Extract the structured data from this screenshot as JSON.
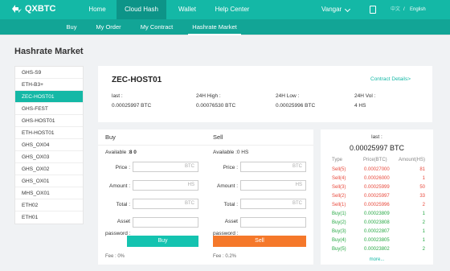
{
  "nav": {
    "logo": "QXBTC",
    "links": [
      "Home",
      "Cloud Hash",
      "Wallet",
      "Help Center"
    ],
    "user": "Vangar",
    "lang_cn": "中文",
    "lang_sep": "/",
    "lang_en": "English"
  },
  "subnav": [
    "Buy",
    "My Order",
    "My Contract",
    "Hashrate Market"
  ],
  "page_title": "Hashrate Market",
  "sidebar": [
    "GHS-S9",
    "ETH-B3+",
    "ZEC-HOST01",
    "GHS-FEST",
    "GHS-HOST01",
    "ETH-HOST01",
    "GHS_OX04",
    "GHS_OX03",
    "GHS_OX02",
    "GHS_OX01",
    "MHS_OX01",
    "ETH02",
    "ETH01"
  ],
  "info": {
    "name": "ZEC-HOST01",
    "details_link": "Contract Details>",
    "stats": [
      {
        "label": "last :",
        "value": "0.00025997 BTC"
      },
      {
        "label": "24H High :",
        "value": "0.00076530 BTC"
      },
      {
        "label": "24H Low :",
        "value": "0.00025996 BTC"
      },
      {
        "label": "24H Vol :",
        "value": "4 HS"
      }
    ]
  },
  "buy": {
    "title": "Buy",
    "available_label": "Available :",
    "available_value": "8 0",
    "price_label": "Price :",
    "price_unit": "BTC",
    "amount_label": "Amount :",
    "amount_unit": "HS",
    "total_label": "Total :",
    "total_unit": "BTC",
    "asset_label_1": "Asset",
    "asset_label_2": "password :",
    "button": "Buy",
    "fee": "Fee : 0%"
  },
  "sell": {
    "title": "Sell",
    "available_label": "Available :",
    "available_value": "0 HS",
    "price_label": "Price :",
    "price_unit": "BTC",
    "amount_label": "Amount :",
    "amount_unit": "HS",
    "total_label": "Total :",
    "total_unit": "BTC",
    "asset_label_1": "Asset",
    "asset_label_2": "password :",
    "button": "Sell",
    "fee": "Fee : 0.2%"
  },
  "book": {
    "last_label": "last :",
    "last_value": "0.00025997 BTC",
    "headers": [
      "Type",
      "Price(BTC)",
      "Amount(HS)"
    ],
    "rows": [
      {
        "type": "Sell(5)",
        "price": "0.00027000",
        "amount": "81",
        "side": "s"
      },
      {
        "type": "Sell(4)",
        "price": "0.00026000",
        "amount": "1",
        "side": "s"
      },
      {
        "type": "Sell(3)",
        "price": "0.00025999",
        "amount": "50",
        "side": "s"
      },
      {
        "type": "Sell(2)",
        "price": "0.00025997",
        "amount": "33",
        "side": "s"
      },
      {
        "type": "Sell(1)",
        "price": "0.00025996",
        "amount": "2",
        "side": "s"
      },
      {
        "type": "Buy(1)",
        "price": "0.00023809",
        "amount": "1",
        "side": "b"
      },
      {
        "type": "Buy(2)",
        "price": "0.00023808",
        "amount": "2",
        "side": "b"
      },
      {
        "type": "Buy(3)",
        "price": "0.00022807",
        "amount": "1",
        "side": "b"
      },
      {
        "type": "Buy(4)",
        "price": "0.00023805",
        "amount": "1",
        "side": "b"
      },
      {
        "type": "Buy(5)",
        "price": "0.00023802",
        "amount": "2",
        "side": "b"
      }
    ],
    "more": "more..."
  }
}
